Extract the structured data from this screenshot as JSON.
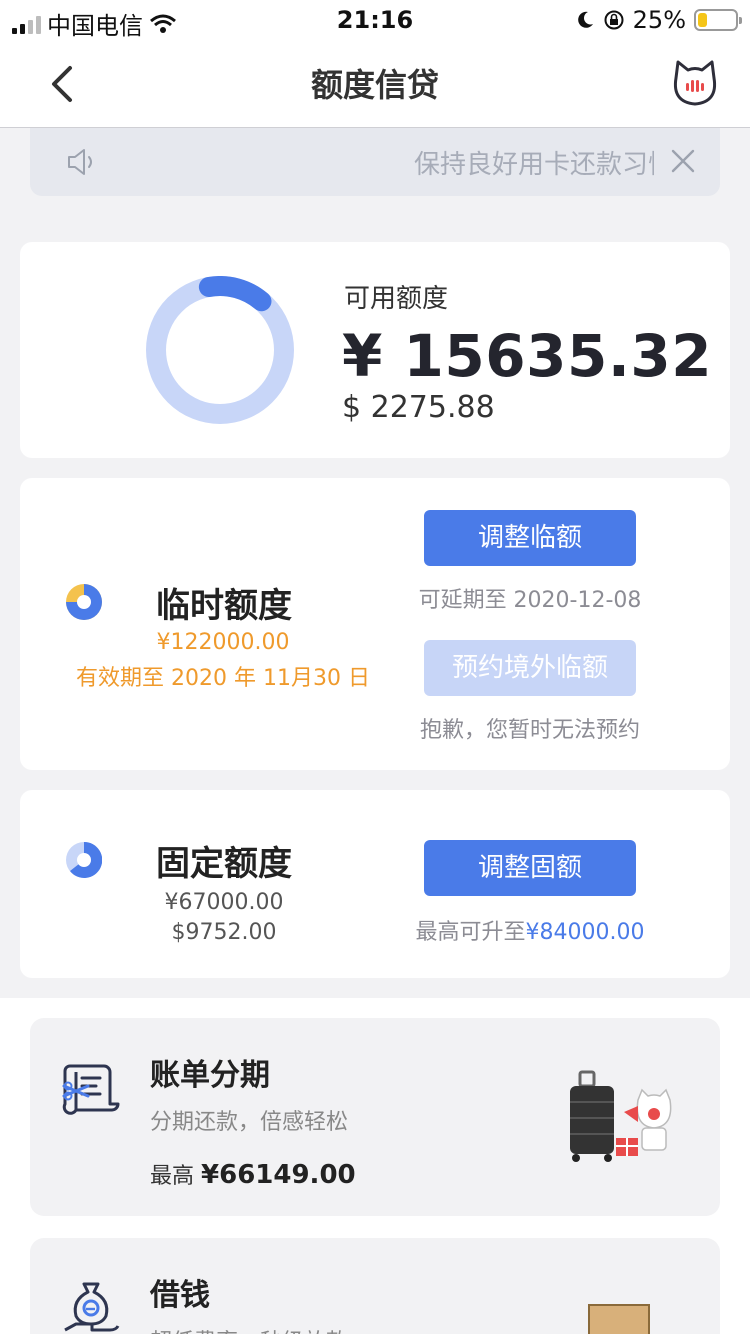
{
  "status_bar": {
    "carrier": "中国电信",
    "time": "21:16",
    "battery_pct": "25%",
    "battery_level": 0.25
  },
  "nav": {
    "title": "额度信贷",
    "back_icon": "chevron-left-icon",
    "avatar_icon": "cat-mascot-icon"
  },
  "notice": {
    "text": "保持良好用卡还款习惯",
    "speaker_icon": "speaker-icon",
    "close_icon": "close-icon"
  },
  "available": {
    "label": "可用额度",
    "amount_cny": "¥ 15635.32",
    "amount_usd": "$ 2275.88",
    "ring_fraction": 0.14,
    "colors": {
      "ring_track": "#c8d6f8",
      "ring_used": "#4a7be8"
    }
  },
  "temporary": {
    "title": "临时额度",
    "amount": "¥122000.00",
    "validity": "有效期至 2020 年 11月30 日",
    "adjust_button": "调整临额",
    "extend_hint": "可延期至 2020-12-08",
    "overseas_button": "预约境外临额",
    "overseas_hint": "抱歉，您暂时无法预约",
    "colors": {
      "accent": "#ef9a2c"
    }
  },
  "fixed": {
    "title": "固定额度",
    "amount_cny": "¥67000.00",
    "amount_usd": "$9752.00",
    "adjust_button": "调整固额",
    "max_prefix": "最高可升至",
    "max_amount": "¥84000.00"
  },
  "promos": [
    {
      "title": "账单分期",
      "subtitle": "分期还款，倍感轻松",
      "max_prefix": "最高",
      "max_amount": "¥66149.00",
      "icon": "bill-installment-icon"
    },
    {
      "title": "借钱",
      "subtitle": "超低费率，秒级放款",
      "icon": "money-bag-hand-icon"
    }
  ],
  "colors": {
    "primary": "#4a7be8",
    "disabled": "#c7d5f7",
    "background": "#f2f2f4"
  }
}
